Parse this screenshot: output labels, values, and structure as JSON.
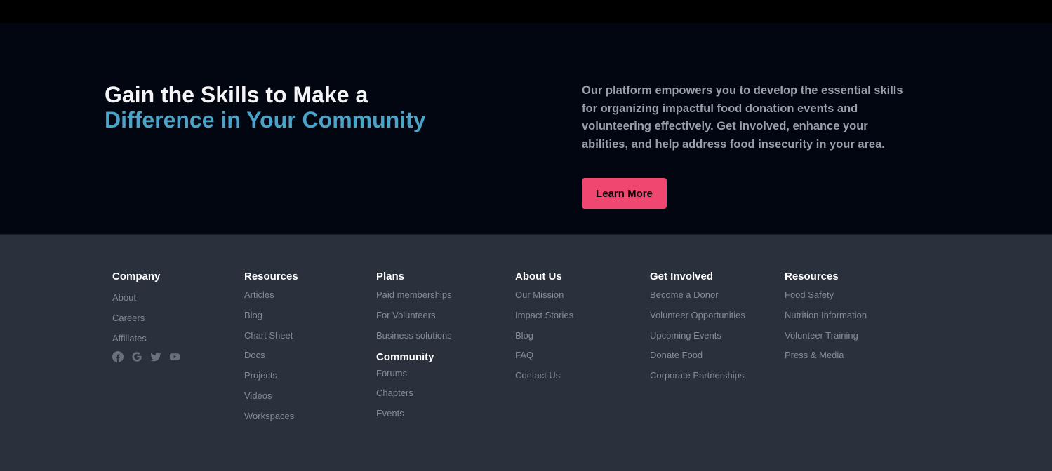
{
  "hero": {
    "title_line1": "Gain the Skills to Make a",
    "title_line2": "Difference in Your Community",
    "description": "Our platform empowers you to develop the essential skills for organizing impactful food donation events and volunteering effectively. Get involved, enhance your abilities, and help address food insecurity in your area.",
    "cta_label": "Learn More",
    "accent_color": "#4ba3c7",
    "cta_color": "#ef4770"
  },
  "footer": {
    "company": {
      "heading": "Company",
      "links": [
        "About",
        "Careers",
        "Affiliates"
      ],
      "social": [
        "facebook-icon",
        "google-icon",
        "twitter-icon",
        "youtube-icon"
      ]
    },
    "resources": {
      "heading": "Resources",
      "links": [
        "Articles",
        "Blog",
        "Chart Sheet",
        "Docs",
        "Projects",
        "Videos",
        "Workspaces"
      ]
    },
    "plans": {
      "heading": "Plans",
      "links": [
        "Paid memberships",
        "For Volunteers",
        "Business solutions"
      ]
    },
    "community": {
      "heading": "Community",
      "links": [
        "Forums",
        "Chapters",
        "Events"
      ]
    },
    "about": {
      "heading": "About Us",
      "links": [
        "Our Mission",
        "Impact Stories",
        "Blog",
        "FAQ",
        "Contact Us"
      ]
    },
    "involved": {
      "heading": "Get Involved",
      "links": [
        "Become a Donor",
        "Volunteer Opportunities",
        "Upcoming Events",
        "Donate Food",
        "Corporate Partnerships"
      ]
    },
    "resources2": {
      "heading": "Resources",
      "links": [
        "Food Safety",
        "Nutrition Information",
        "Volunteer Training",
        "Press & Media"
      ]
    }
  }
}
